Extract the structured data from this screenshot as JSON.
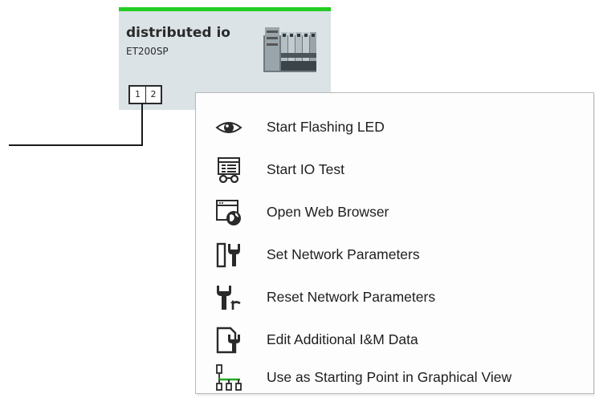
{
  "device": {
    "name": "distributed io",
    "type": "ET200SP",
    "ports": [
      "1",
      "2"
    ],
    "status_color": "#22cc22"
  },
  "context_menu": {
    "items": [
      {
        "label": "Start Flashing LED",
        "icon": "eye-icon"
      },
      {
        "label": "Start IO Test",
        "icon": "io-test-icon"
      },
      {
        "label": "Open Web Browser",
        "icon": "web-browser-icon"
      },
      {
        "label": "Set Network Parameters",
        "icon": "set-network-parameters-icon"
      },
      {
        "label": "Reset Network Parameters",
        "icon": "reset-network-parameters-icon"
      },
      {
        "label": "Edit Additional I&M Data",
        "icon": "edit-im-data-icon"
      },
      {
        "label": "Use as Starting Point in Graphical View",
        "icon": "graphical-view-icon"
      }
    ]
  }
}
